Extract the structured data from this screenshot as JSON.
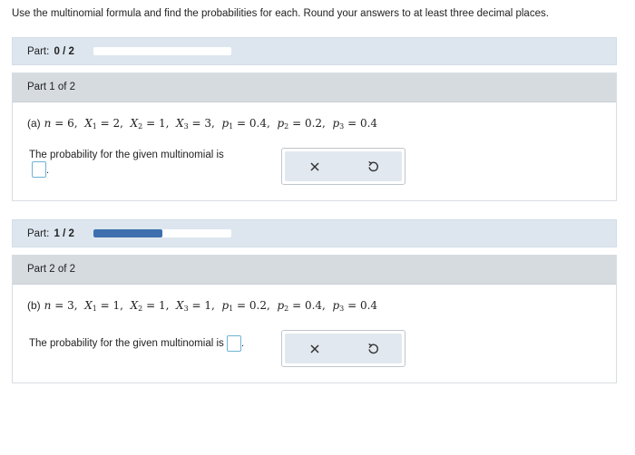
{
  "instruction": "Use the multinomial formula and find the probabilities for each. Round your answers to at least three decimal places.",
  "parts": [
    {
      "progress_label": "Part:",
      "progress_value": "0 / 2",
      "progress_fraction": 0.0,
      "header": "Part 1 of 2",
      "problem_label": "(a)",
      "n": "6",
      "X1": "2",
      "X2": "1",
      "X3": "3",
      "p1": "0.4",
      "p2": "0.2",
      "p3": "0.4",
      "prompt": "The probability for the given multinomial is",
      "answer_value": ""
    },
    {
      "progress_label": "Part:",
      "progress_value": "1 / 2",
      "progress_fraction": 0.5,
      "header": "Part 2 of 2",
      "problem_label": "(b)",
      "n": "3",
      "X1": "1",
      "X2": "1",
      "X3": "1",
      "p1": "0.2",
      "p2": "0.4",
      "p3": "0.4",
      "prompt": "The probability for the given multinomial is",
      "answer_value": ""
    }
  ],
  "tools": {
    "clear_icon": "x-icon",
    "undo_icon": "undo-icon"
  },
  "colors": {
    "progress_fill": "#3d6fae",
    "part_bar_bg": "#dde6ef",
    "answer_box_border": "#6fb2d3"
  }
}
